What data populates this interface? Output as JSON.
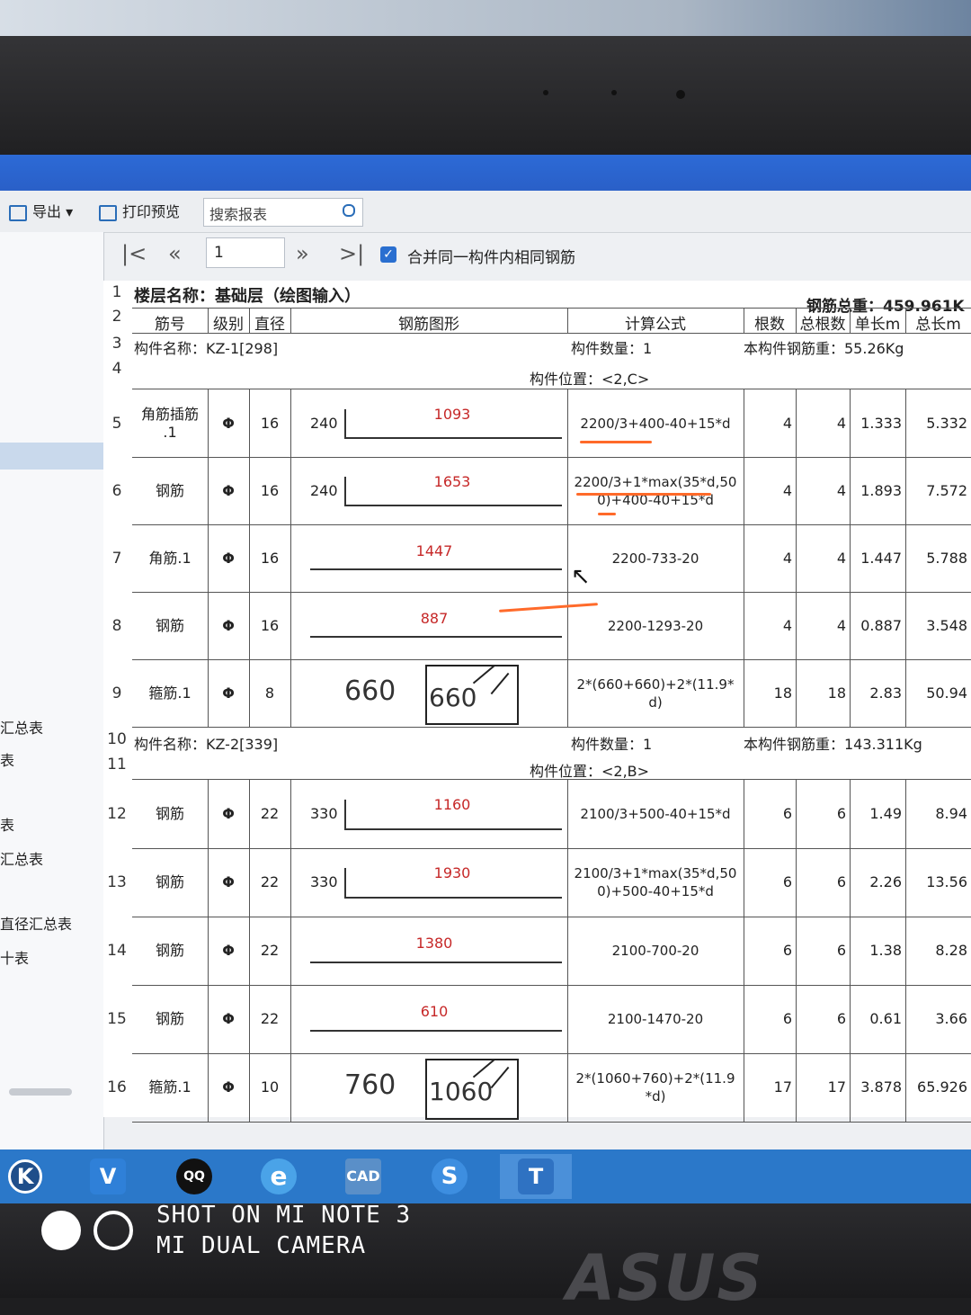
{
  "toolbar": {
    "export": "导出",
    "print_preview": "打印预览",
    "search_placeholder": "搜索报表"
  },
  "nav": {
    "first": "|<",
    "prev": "«",
    "page": "1",
    "next": "»",
    "last": ">|",
    "merge_checked": true,
    "merge_label": "合并同一构件内相同钢筋"
  },
  "sidebar": {
    "items": [
      "汇总表",
      "表",
      "表",
      "汇总表",
      "直径汇总表",
      "十表"
    ]
  },
  "report": {
    "floor": "楼层名称：基础层（绘图输入）",
    "total_weight": "钢筋总重：459.961K",
    "headers": [
      "筋号",
      "级别",
      "直径",
      "钢筋图形",
      "计算公式",
      "根数",
      "总根数",
      "单长m",
      "总长m"
    ],
    "member1": {
      "name": "构件名称：KZ-1[298]",
      "count": "构件数量：1",
      "weight": "本构件钢筋重：55.26Kg",
      "position": "构件位置：<2,C>"
    },
    "member2": {
      "name": "构件名称：KZ-2[339]",
      "count": "构件数量：1",
      "weight": "本构件钢筋重：143.311Kg",
      "position": "构件位置：<2,B>"
    },
    "rows": [
      {
        "n": "5",
        "name": "角筋插筋\n.1",
        "grade": "Φ",
        "dia": "16",
        "bend": "240",
        "len": "1093",
        "formula": "2200/3+400-40+15*d",
        "cnt": "4",
        "tot": "4",
        "unit": "1.333",
        "total": "5.332"
      },
      {
        "n": "6",
        "name": "钢筋",
        "grade": "Φ",
        "dia": "16",
        "bend": "240",
        "len": "1653",
        "formula": "2200/3+1*max(35*d,50\n0)+400-40+15*d",
        "cnt": "4",
        "tot": "4",
        "unit": "1.893",
        "total": "7.572"
      },
      {
        "n": "7",
        "name": "角筋.1",
        "grade": "Φ",
        "dia": "16",
        "bend": "",
        "len": "1447",
        "formula": "2200-733-20",
        "cnt": "4",
        "tot": "4",
        "unit": "1.447",
        "total": "5.788"
      },
      {
        "n": "8",
        "name": "钢筋",
        "grade": "Φ",
        "dia": "16",
        "bend": "",
        "len": "887",
        "formula": "2200-1293-20",
        "cnt": "4",
        "tot": "4",
        "unit": "0.887",
        "total": "3.548"
      },
      {
        "n": "9",
        "name": "箍筋.1",
        "grade": "Φ",
        "dia": "8",
        "bend": "660",
        "len": "660",
        "formula": "2*(660+660)+2*(11.9*\nd)",
        "cnt": "18",
        "tot": "18",
        "unit": "2.83",
        "total": "50.94"
      },
      {
        "n": "12",
        "name": "钢筋",
        "grade": "Φ",
        "dia": "22",
        "bend": "330",
        "len": "1160",
        "formula": "2100/3+500-40+15*d",
        "cnt": "6",
        "tot": "6",
        "unit": "1.49",
        "total": "8.94"
      },
      {
        "n": "13",
        "name": "钢筋",
        "grade": "Φ",
        "dia": "22",
        "bend": "330",
        "len": "1930",
        "formula": "2100/3+1*max(35*d,50\n0)+500-40+15*d",
        "cnt": "6",
        "tot": "6",
        "unit": "2.26",
        "total": "13.56"
      },
      {
        "n": "14",
        "name": "钢筋",
        "grade": "Φ",
        "dia": "22",
        "bend": "",
        "len": "1380",
        "formula": "2100-700-20",
        "cnt": "6",
        "tot": "6",
        "unit": "1.38",
        "total": "8.28"
      },
      {
        "n": "15",
        "name": "钢筋",
        "grade": "Φ",
        "dia": "22",
        "bend": "",
        "len": "610",
        "formula": "2100-1470-20",
        "cnt": "6",
        "tot": "6",
        "unit": "0.61",
        "total": "3.66"
      },
      {
        "n": "16",
        "name": "箍筋.1",
        "grade": "Φ",
        "dia": "10",
        "bend": "760",
        "len": "1060",
        "formula": "2*(1060+760)+2*(11.9\n*d)",
        "cnt": "17",
        "tot": "17",
        "unit": "3.878",
        "total": "65.926"
      }
    ]
  },
  "watermark": {
    "line1": "SHOT ON MI NOTE 3",
    "line2": "MI DUAL CAMERA"
  },
  "brand": "ASUS",
  "taskbar": {
    "icons": [
      "K",
      "V",
      "QQ",
      "e",
      "CAD",
      "S",
      "T"
    ]
  }
}
